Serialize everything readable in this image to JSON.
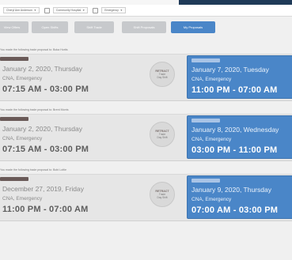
{
  "filters": {
    "group1_value": "Cheryl Ann Anderson",
    "group2_value": "Community Hospital",
    "group3_value": "Emergency"
  },
  "toolbar": {
    "buttons": [
      "View Offers",
      "Open Shifts",
      "Shift Trade",
      "Shift Proposals",
      "My Proposals"
    ]
  },
  "proposals": [
    {
      "offer_text": "You made the following trade proposal to: Boka Hortis",
      "left": {
        "date": "January 2, 2020, Thursday",
        "unit": "CNA, Emergency",
        "time": "07:15 AM - 03:00 PM"
      },
      "badge": {
        "title": "RETRACT",
        "line1": "Trade",
        "line2": "Day Shift"
      },
      "right": {
        "date": "January 7, 2020, Tuesday",
        "unit": "CNA, Emergency",
        "time": "11:00 PM - 07:00 AM"
      }
    },
    {
      "offer_text": "You made the following trade proposal to: Brent Morris",
      "left": {
        "date": "January 2, 2020, Thursday",
        "unit": "CNA, Emergency",
        "time": "07:15 AM - 03:00 PM"
      },
      "badge": {
        "title": "RETRACT",
        "line1": "Trade",
        "line2": "Day Shift"
      },
      "right": {
        "date": "January 8, 2020, Wednesday",
        "unit": "CNA, Emergency",
        "time": "03:00 PM - 11:00 PM"
      }
    },
    {
      "offer_text": "You made the following trade proposal to: Bobi Lottie",
      "left": {
        "date": "December 27, 2019, Friday",
        "unit": "CNA, Emergency",
        "time": "11:00 PM - 07:00 AM"
      },
      "badge": {
        "title": "RETRACT",
        "line1": "Trade",
        "line2": "Day Shift"
      },
      "right": {
        "date": "January 9, 2020, Thursday",
        "unit": "CNA, Emergency",
        "time": "07:00 AM - 03:00 PM"
      }
    }
  ]
}
